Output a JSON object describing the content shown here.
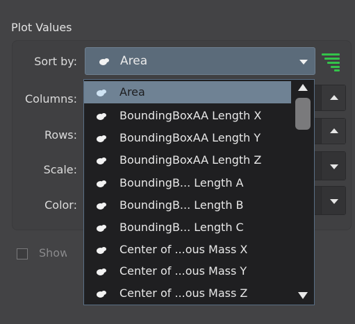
{
  "panel": {
    "title": "Plot Values"
  },
  "labels": {
    "sort_by": "Sort by:",
    "columns": "Columns:",
    "rows": "Rows:",
    "scale": "Scale:",
    "color": "Color:"
  },
  "sort": {
    "selected": "Area"
  },
  "checkbox": {
    "label": "Show A",
    "checked": false
  },
  "dropdown": {
    "items": [
      "Area",
      "BoundingBoxAA Length X",
      "BoundingBoxAA Length Y",
      "BoundingBoxAA Length Z",
      "BoundingB... Length A",
      "BoundingB... Length B",
      "BoundingB... Length C",
      "Center of ...ous Mass X",
      "Center of ...ous Mass Y",
      "Center of ...ous Mass Z"
    ]
  },
  "icons": {
    "item_icon": "surface-blob-icon",
    "sort_order_icon": "sort-lines-icon"
  },
  "colors": {
    "accent_green": "#34c34a",
    "selection": "#6f8294"
  }
}
